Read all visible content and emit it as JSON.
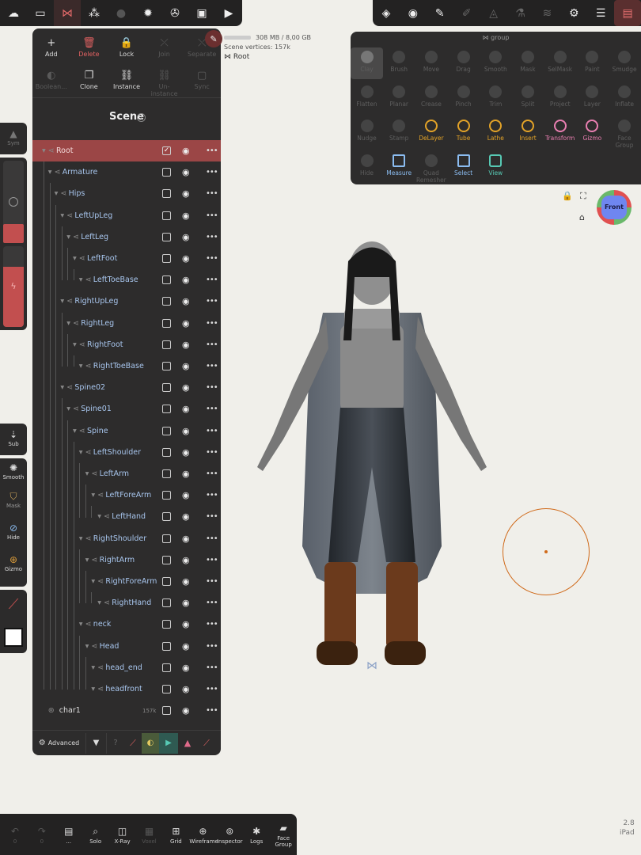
{
  "top_left_toolbar": [
    {
      "name": "logo-icon",
      "glyph": "☁"
    },
    {
      "name": "folder-icon",
      "glyph": "▭"
    },
    {
      "name": "scene-graph-icon",
      "glyph": "⋈",
      "active": true
    },
    {
      "name": "shapes-icon",
      "glyph": "⁂"
    },
    {
      "name": "material-icon",
      "glyph": "●",
      "dim": true
    },
    {
      "name": "light-icon",
      "glyph": "✹"
    },
    {
      "name": "render-icon",
      "glyph": "✇"
    },
    {
      "name": "image-icon",
      "glyph": "▣"
    },
    {
      "name": "camera-icon",
      "glyph": "▶"
    }
  ],
  "top_right_toolbar": [
    {
      "name": "layers-stack-icon",
      "glyph": "◈"
    },
    {
      "name": "matcap-icon",
      "glyph": "◉"
    },
    {
      "name": "brush-icon",
      "glyph": "✎"
    },
    {
      "name": "eraser-icon",
      "glyph": "✐",
      "dim": true
    },
    {
      "name": "triangle-icon",
      "glyph": "◬",
      "dim": true
    },
    {
      "name": "flask-icon",
      "glyph": "⚗",
      "dim": true
    },
    {
      "name": "layers-icon",
      "glyph": "≋",
      "dim": true
    },
    {
      "name": "settings-icon",
      "glyph": "⚙"
    },
    {
      "name": "sliders-icon",
      "glyph": "☰"
    },
    {
      "name": "tools-palette-icon",
      "glyph": "▤",
      "active": true
    }
  ],
  "status": {
    "memory": "308 MB / 8,00 GB",
    "vertices": "Scene vertices:  157k",
    "crumb": "Root"
  },
  "scene_actions_row1": [
    {
      "name": "add-button",
      "label": "Add",
      "glyph": "+"
    },
    {
      "name": "delete-button",
      "label": "Delete",
      "glyph": "🗑",
      "color": "red"
    },
    {
      "name": "lock-button",
      "label": "Lock",
      "glyph": "🔒"
    },
    {
      "name": "join-button",
      "label": "Join",
      "glyph": "⤫",
      "disabled": true
    },
    {
      "name": "separate-button",
      "label": "Separate",
      "glyph": "⤬",
      "disabled": true
    }
  ],
  "scene_actions_row2": [
    {
      "name": "boolean-button",
      "label": "Boolean...",
      "glyph": "◐",
      "disabled": true
    },
    {
      "name": "clone-button",
      "label": "Clone",
      "glyph": "❐"
    },
    {
      "name": "instance-button",
      "label": "Instance",
      "glyph": "⛓"
    },
    {
      "name": "un-instance-button",
      "label": "Un-instance",
      "glyph": "⛓",
      "disabled": true
    },
    {
      "name": "sync-button",
      "label": "Sync",
      "glyph": "▢",
      "disabled": true
    }
  ],
  "scene": {
    "title": "Scene",
    "help": "?",
    "tree": [
      {
        "label": "Root",
        "depth": 0,
        "selected": true,
        "checked": true
      },
      {
        "label": "Armature",
        "depth": 1
      },
      {
        "label": "Hips",
        "depth": 2
      },
      {
        "label": "LeftUpLeg",
        "depth": 3
      },
      {
        "label": "LeftLeg",
        "depth": 4
      },
      {
        "label": "LeftFoot",
        "depth": 5
      },
      {
        "label": "LeftToeBase",
        "depth": 6
      },
      {
        "label": "RightUpLeg",
        "depth": 3
      },
      {
        "label": "RightLeg",
        "depth": 4
      },
      {
        "label": "RightFoot",
        "depth": 5
      },
      {
        "label": "RightToeBase",
        "depth": 6
      },
      {
        "label": "Spine02",
        "depth": 3
      },
      {
        "label": "Spine01",
        "depth": 4
      },
      {
        "label": "Spine",
        "depth": 5
      },
      {
        "label": "LeftShoulder",
        "depth": 6
      },
      {
        "label": "LeftArm",
        "depth": 7
      },
      {
        "label": "LeftForeArm",
        "depth": 8
      },
      {
        "label": "LeftHand",
        "depth": 9
      },
      {
        "label": "RightShoulder",
        "depth": 6
      },
      {
        "label": "RightArm",
        "depth": 7
      },
      {
        "label": "RightForeArm",
        "depth": 8
      },
      {
        "label": "RightHand",
        "depth": 9
      },
      {
        "label": "neck",
        "depth": 6
      },
      {
        "label": "Head",
        "depth": 7
      },
      {
        "label": "head_end",
        "depth": 8
      },
      {
        "label": "headfront",
        "depth": 8
      },
      {
        "label": "char1",
        "depth": 1,
        "mesh": true,
        "count": "157k"
      }
    ],
    "footer": {
      "advanced": "Advanced"
    }
  },
  "left_tools": {
    "sym": "Sym",
    "sub": "Sub",
    "smooth": "Smooth",
    "mask": "Mask",
    "hide": "Hide",
    "gizmo": "Gizmo"
  },
  "tools_panel": {
    "header": "group",
    "tools": [
      {
        "label": "Clay",
        "style": "sel"
      },
      {
        "label": "Brush"
      },
      {
        "label": "Move"
      },
      {
        "label": "Drag"
      },
      {
        "label": "Smooth"
      },
      {
        "label": "Mask"
      },
      {
        "label": "SelMask"
      },
      {
        "label": "Paint"
      },
      {
        "label": "Smudge"
      },
      {
        "label": "Flatten"
      },
      {
        "label": "Planar"
      },
      {
        "label": "Crease"
      },
      {
        "label": "Pinch"
      },
      {
        "label": "Trim"
      },
      {
        "label": "Split"
      },
      {
        "label": "Project"
      },
      {
        "label": "Layer"
      },
      {
        "label": "Inflate"
      },
      {
        "label": "Nudge"
      },
      {
        "label": "Stamp"
      },
      {
        "label": "DeLayer",
        "style": "orange"
      },
      {
        "label": "Tube",
        "style": "orange"
      },
      {
        "label": "Lathe",
        "style": "orange"
      },
      {
        "label": "Insert",
        "style": "orange"
      },
      {
        "label": "Transform",
        "style": "pink"
      },
      {
        "label": "Gizmo",
        "style": "pink"
      },
      {
        "label": "Face Group"
      },
      {
        "label": "Hide"
      },
      {
        "label": "Measure",
        "style": "blue"
      },
      {
        "label": "Quad Remesher"
      },
      {
        "label": "Select",
        "style": "blue"
      },
      {
        "label": "View",
        "style": "teal"
      }
    ]
  },
  "view_cube": {
    "label": "Front"
  },
  "bottom_toolbar": [
    {
      "name": "undo-button",
      "label": "0",
      "glyph": "↶",
      "disabled": true
    },
    {
      "name": "redo-button",
      "label": "0",
      "glyph": "↷",
      "disabled": true
    },
    {
      "name": "menu-button",
      "label": "...",
      "glyph": "▤"
    },
    {
      "name": "solo-button",
      "label": "Solo",
      "glyph": "⌕"
    },
    {
      "name": "xray-button",
      "label": "X-Ray",
      "glyph": "◫"
    },
    {
      "name": "voxel-button",
      "label": "Voxel",
      "glyph": "▦",
      "disabled": true
    },
    {
      "name": "grid-button",
      "label": "Grid",
      "glyph": "⊞"
    },
    {
      "name": "wireframe-button",
      "label": "Wireframe",
      "glyph": "⊕"
    },
    {
      "name": "inspector-button",
      "label": "Inspector",
      "glyph": "⊚"
    },
    {
      "name": "logs-button",
      "label": "Logs",
      "glyph": "✱"
    },
    {
      "name": "face-group-button",
      "label": "Face Group",
      "glyph": "▰"
    }
  ],
  "version": {
    "number": "2.8",
    "device": "iPad"
  }
}
